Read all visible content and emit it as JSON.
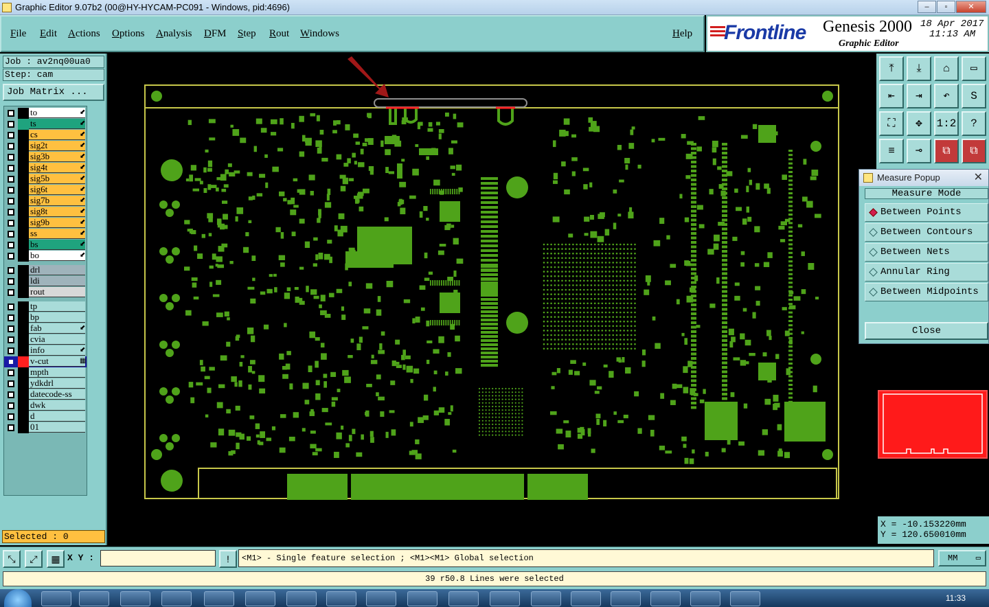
{
  "window": {
    "title": "Graphic Editor 9.07b2 (00@HY-HYCAM-PC091 - Windows, pid:4696)",
    "controls": [
      "–",
      "▫",
      "✕"
    ]
  },
  "menu": {
    "items": [
      "File",
      "Edit",
      "Actions",
      "Options",
      "Analysis",
      "DFM",
      "Step",
      "Rout",
      "Windows"
    ],
    "help": "Help"
  },
  "brand": {
    "logo": "Frontline",
    "product": "Genesis 2000",
    "subtitle": "Graphic Editor",
    "date": "18 Apr 2017",
    "time": "11:13 AM"
  },
  "job": {
    "job_line": "Job : av2nq00ua0",
    "step_line": "Step: cam",
    "matrix_button": "Job Matrix ..."
  },
  "layers": {
    "groups": [
      [
        {
          "name": "to",
          "color": "#ffffff",
          "swatch": "#000000",
          "mark": "⬋"
        },
        {
          "name": "ts",
          "color": "#1fa37e",
          "swatch": "#1fa37e",
          "mark": "⬋"
        },
        {
          "name": "cs",
          "color": "#ffc040",
          "swatch": "#000000",
          "mark": "⬋"
        },
        {
          "name": "sig2t",
          "color": "#ffc040",
          "swatch": "#000000",
          "mark": "⬋"
        },
        {
          "name": "sig3b",
          "color": "#ffc040",
          "swatch": "#000000",
          "mark": "⬋"
        },
        {
          "name": "sig4t",
          "color": "#ffc040",
          "swatch": "#000000",
          "mark": "⬋"
        },
        {
          "name": "sig5b",
          "color": "#ffc040",
          "swatch": "#000000",
          "mark": "⬋"
        },
        {
          "name": "sig6t",
          "color": "#ffc040",
          "swatch": "#000000",
          "mark": "⬋"
        },
        {
          "name": "sig7b",
          "color": "#ffc040",
          "swatch": "#000000",
          "mark": "⬋"
        },
        {
          "name": "sig8t",
          "color": "#ffc040",
          "swatch": "#000000",
          "mark": "⬋"
        },
        {
          "name": "sig9b",
          "color": "#ffc040",
          "swatch": "#000000",
          "mark": "⬋"
        },
        {
          "name": "ss",
          "color": "#ffc040",
          "swatch": "#000000",
          "mark": "⬋"
        },
        {
          "name": "bs",
          "color": "#1fa37e",
          "swatch": "#000000",
          "mark": "⬋"
        },
        {
          "name": "bo",
          "color": "#ffffff",
          "swatch": "#000000",
          "mark": "⬋"
        }
      ],
      [
        {
          "name": "drl",
          "color": "#9fb3bb",
          "swatch": "#000000",
          "mark": ""
        },
        {
          "name": "ldi",
          "color": "#9fb3bb",
          "swatch": "#000000",
          "mark": ""
        },
        {
          "name": "rout",
          "color": "#d8d8d8",
          "swatch": "#000000",
          "mark": ""
        }
      ],
      [
        {
          "name": "tp",
          "color": "#a9dcd9",
          "swatch": "#000000",
          "mark": ""
        },
        {
          "name": "bp",
          "color": "#a9dcd9",
          "swatch": "#000000",
          "mark": ""
        },
        {
          "name": "fab",
          "color": "#a9dcd9",
          "swatch": "#000000",
          "mark": "⬋"
        },
        {
          "name": "cvia",
          "color": "#a9dcd9",
          "swatch": "#000000",
          "mark": ""
        },
        {
          "name": "info",
          "color": "#a9dcd9",
          "swatch": "#000000",
          "mark": "⬋"
        },
        {
          "name": "v-cut",
          "color": "#a9dcd9",
          "swatch": "#ff2020",
          "mark": "▦",
          "active": true
        },
        {
          "name": "mpth",
          "color": "#a9dcd9",
          "swatch": "#000000",
          "mark": ""
        },
        {
          "name": "ydkdrl",
          "color": "#a9dcd9",
          "swatch": "#000000",
          "mark": ""
        },
        {
          "name": "datecode-ss",
          "color": "#a9dcd9",
          "swatch": "#000000",
          "mark": ""
        },
        {
          "name": "dwk",
          "color": "#a9dcd9",
          "swatch": "#000000",
          "mark": ""
        },
        {
          "name": "d",
          "color": "#a9dcd9",
          "swatch": "#000000",
          "mark": ""
        },
        {
          "name": "01",
          "color": "#a9dcd9",
          "swatch": "#000000",
          "mark": ""
        }
      ]
    ]
  },
  "selected": "Selected : 0",
  "right_tools": [
    [
      "⤒",
      "⤓",
      "⌂",
      "▭"
    ],
    [
      "⇤",
      "⇥",
      "↶",
      "S"
    ],
    [
      "⛶",
      "✥",
      "1:2",
      "?"
    ],
    [
      "≡",
      "⊸",
      "⧉",
      "⧉"
    ]
  ],
  "measure_popup": {
    "title": "Measure Popup",
    "mode_header": "Measure Mode",
    "options": [
      "Between Points",
      "Between Contours",
      "Between Nets",
      "Annular Ring",
      "Between Midpoints"
    ],
    "selected_index": 0,
    "close_label": "Close"
  },
  "coords": {
    "x": "X = -10.153220mm",
    "y": "Y = 120.650010mm"
  },
  "command_bar": {
    "xy_label": "X Y :",
    "xy_value": "",
    "hint": "<M1> - Single feature selection ; <M1><M1> Global selection",
    "unit": "MM"
  },
  "status": "39 r50.8 Lines were selected",
  "taskbar": {
    "clock": "11:33"
  },
  "colors": {
    "panel": "#8ccfcc",
    "board": "#4fa31a",
    "outline": "#c8c84a",
    "highlight": "#ff2020"
  }
}
